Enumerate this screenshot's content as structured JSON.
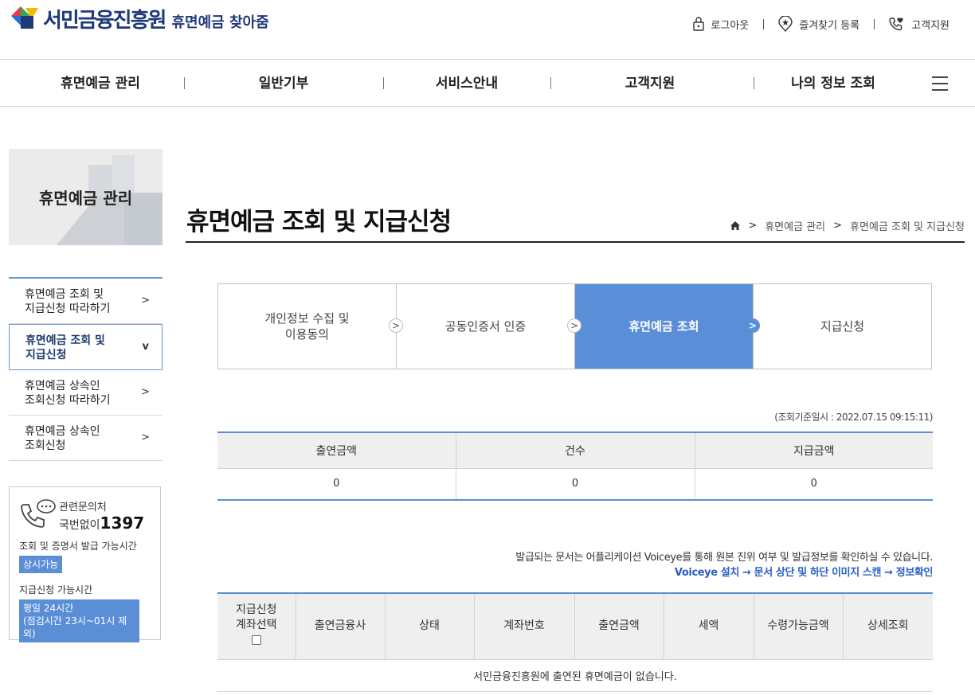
{
  "header": {
    "org_name": "서민금융진흥원",
    "service_name": "휴면예금 찾아줌",
    "util": {
      "logout": "로그아웃",
      "bookmark": "즐겨찾기 등록",
      "support": "고객지원"
    }
  },
  "gnb": [
    "휴면예금 관리",
    "일반기부",
    "서비스안내",
    "고객지원",
    "나의 정보 조회"
  ],
  "sidebar": {
    "banner_title": "휴면예금 관리",
    "menu": [
      {
        "line1": "휴면예금 조회 및",
        "line2": "지급신청 따라하기",
        "arrow": ">"
      },
      {
        "line1": "휴면예금 조회 및",
        "line2": "지급신청",
        "arrow": "v"
      },
      {
        "line1": "휴면예금 상속인",
        "line2": "조회신청 따라하기",
        "arrow": ">"
      },
      {
        "line1": "휴면예금 상속인",
        "line2": "조회신청",
        "arrow": ">"
      }
    ],
    "contact": {
      "label": "관련문의처",
      "prefix": "국번없이",
      "number": "1397",
      "hours1_label": "조회 및 증명서 발급 가능시간",
      "hours1_value": "상시가능",
      "hours2_label": "지급신청 가능시간",
      "hours2_line1": "평일 24시간",
      "hours2_line2": "(점검시간 23시~01시 제외)"
    }
  },
  "main": {
    "title": "휴면예금 조회 및 지급신청",
    "breadcrumb": [
      ">",
      "휴면예금 관리",
      ">",
      "휴면예금 조회 및 지급신청"
    ],
    "steps": [
      {
        "line1": "개인정보 수집 및",
        "line2": "이용동의"
      },
      {
        "line1": "공동인증서 인증",
        "line2": ""
      },
      {
        "line1": "휴면예금 조회",
        "line2": ""
      },
      {
        "line1": "지급신청",
        "line2": ""
      }
    ],
    "chevron": ">",
    "basis": "(조회기준일시 : 2022.07.15 09:15:11)",
    "summary": {
      "headers": [
        "출연금액",
        "건수",
        "지급금액"
      ],
      "values": [
        "0",
        "0",
        "0"
      ]
    },
    "notice": "발급되는 문서는 어플리케이션 Voiceye를 통해 원본 진위 여부 및 발급정보를 확인하실 수 있습니다.",
    "notice_link": "Voiceye 설치 → 문서 상단 및 하단 이미지 스캔 → 정보확인",
    "accounts": {
      "select_header_line1": "지급신청",
      "select_header_line2": "계좌선택",
      "headers": [
        "출연금융사",
        "상태",
        "계좌번호",
        "출연금액",
        "세액",
        "수령가능금액",
        "상세조회"
      ],
      "empty_message": "서민금융진흥원에 출연된 휴면예금이 없습니다."
    }
  },
  "colors": {
    "brand": "#1f3a7a",
    "accent": "#5a8fd8"
  }
}
